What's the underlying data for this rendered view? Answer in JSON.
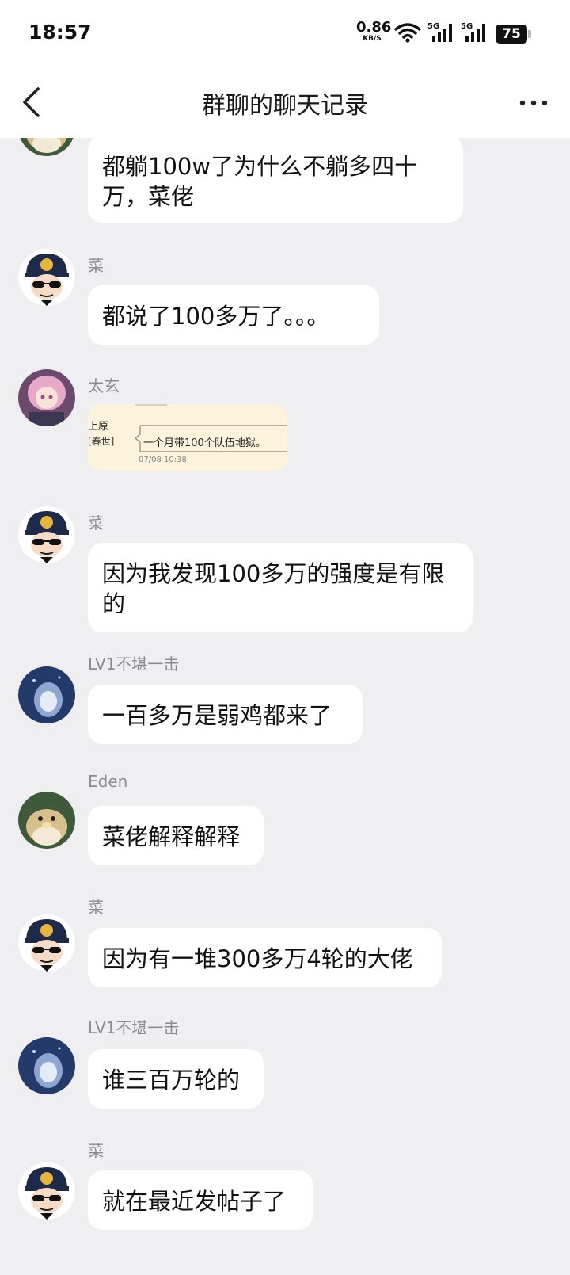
{
  "status_bar": {
    "time": "18:57",
    "net_speed": "0.86",
    "net_unit": "KB/S",
    "signal_1": "5G",
    "signal_2": "5G",
    "battery": "75"
  },
  "header": {
    "title": "群聊的聊天记录"
  },
  "messages": [
    {
      "sender": "",
      "avatar": "eden-avatar",
      "text": "都躺100w了为什么不躺多四十万，菜佬"
    },
    {
      "sender": "菜",
      "avatar": "cai-avatar",
      "text": "都说了100多万了。。。"
    },
    {
      "sender": "太玄",
      "avatar": "taixuan-avatar",
      "image": {
        "left_text_1": "上原",
        "left_text_2": "[春世]",
        "quote": "一个月带100个队伍地狱。",
        "timestamp": "07/08 10:38"
      }
    },
    {
      "sender": "菜",
      "avatar": "cai-avatar",
      "text": "因为我发现100多万的强度是有限的"
    },
    {
      "sender": "LV1不堪一击",
      "avatar": "lv1-avatar",
      "text": "一百多万是弱鸡都来了"
    },
    {
      "sender": "Eden",
      "avatar": "eden-avatar",
      "text": "菜佬解释解释"
    },
    {
      "sender": "菜",
      "avatar": "cai-avatar",
      "text": "因为有一堆300多万4轮的大佬"
    },
    {
      "sender": "LV1不堪一击",
      "avatar": "lv1-avatar",
      "text": "谁三百万轮的"
    },
    {
      "sender": "菜",
      "avatar": "cai-avatar",
      "text": "就在最近发帖子了"
    }
  ],
  "colors": {
    "background": "#efeff2",
    "bubble": "#ffffff",
    "name": "#8c8c8c"
  }
}
